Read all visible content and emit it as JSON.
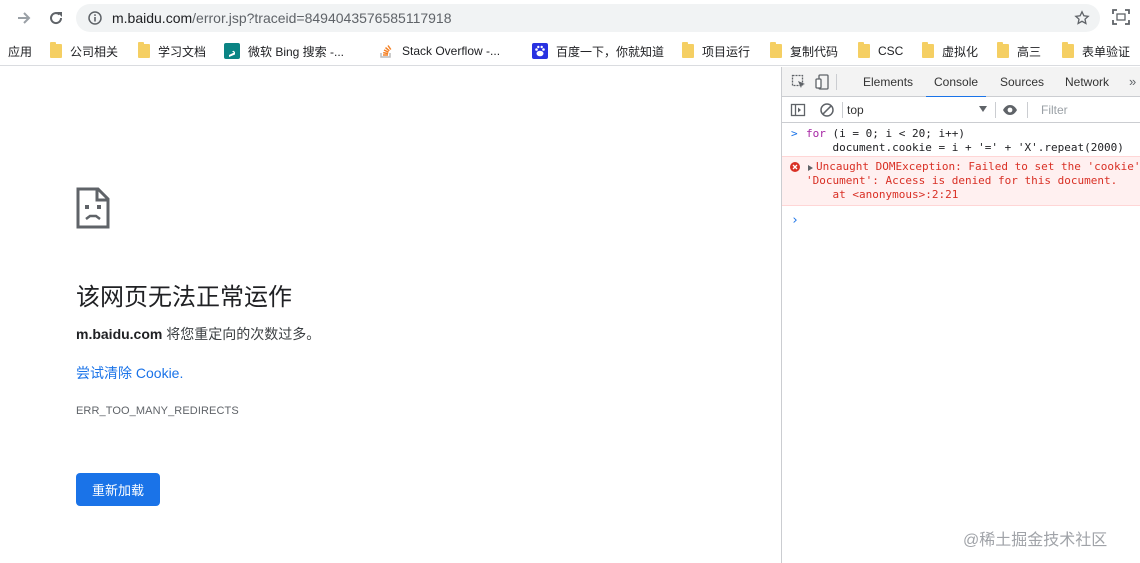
{
  "browser": {
    "url_host": "m.baidu.com",
    "url_path": "/error.jsp?traceid=8494043576585117918"
  },
  "bookmarks": {
    "apps_label": "应用",
    "items": [
      {
        "label": "公司相关",
        "icon": "folder-icon"
      },
      {
        "label": "学习文档",
        "icon": "folder-icon"
      },
      {
        "label": "微软 Bing 搜索 -...",
        "icon": "bing-icon"
      },
      {
        "label": "Stack Overflow -...",
        "icon": "stackoverflow-icon"
      },
      {
        "label": "百度一下，你就知道",
        "icon": "baidu-icon"
      },
      {
        "label": "项目运行",
        "icon": "folder-icon"
      },
      {
        "label": "复制代码",
        "icon": "folder-icon"
      },
      {
        "label": "CSC",
        "icon": "folder-icon"
      },
      {
        "label": "虚拟化",
        "icon": "folder-icon"
      },
      {
        "label": "高三",
        "icon": "folder-icon"
      },
      {
        "label": "表单验证",
        "icon": "folder-icon"
      }
    ]
  },
  "error_page": {
    "title": "该网页无法正常运作",
    "host": "m.baidu.com",
    "message_suffix": " 将您重定向的次数过多。",
    "link_text": "尝试清除 Cookie.",
    "error_code": "ERR_TOO_MANY_REDIRECTS",
    "reload_label": "重新加载"
  },
  "devtools": {
    "tabs": [
      "Elements",
      "Console",
      "Sources",
      "Network"
    ],
    "active_tab": "Console",
    "context": "top",
    "filter_placeholder": "Filter",
    "console": {
      "input_line1": "for (i = 0; i < 20; i++)",
      "input_line2": "    document.cookie = i + '=' + 'X'.repeat(2000)",
      "error_line1": "Uncaught DOMException: Failed to set the 'cookie'",
      "error_line2": "'Document': Access is denied for this document.",
      "error_line3": "    at <anonymous>:2:21"
    }
  },
  "watermark": "@稀土掘金技术社区"
}
